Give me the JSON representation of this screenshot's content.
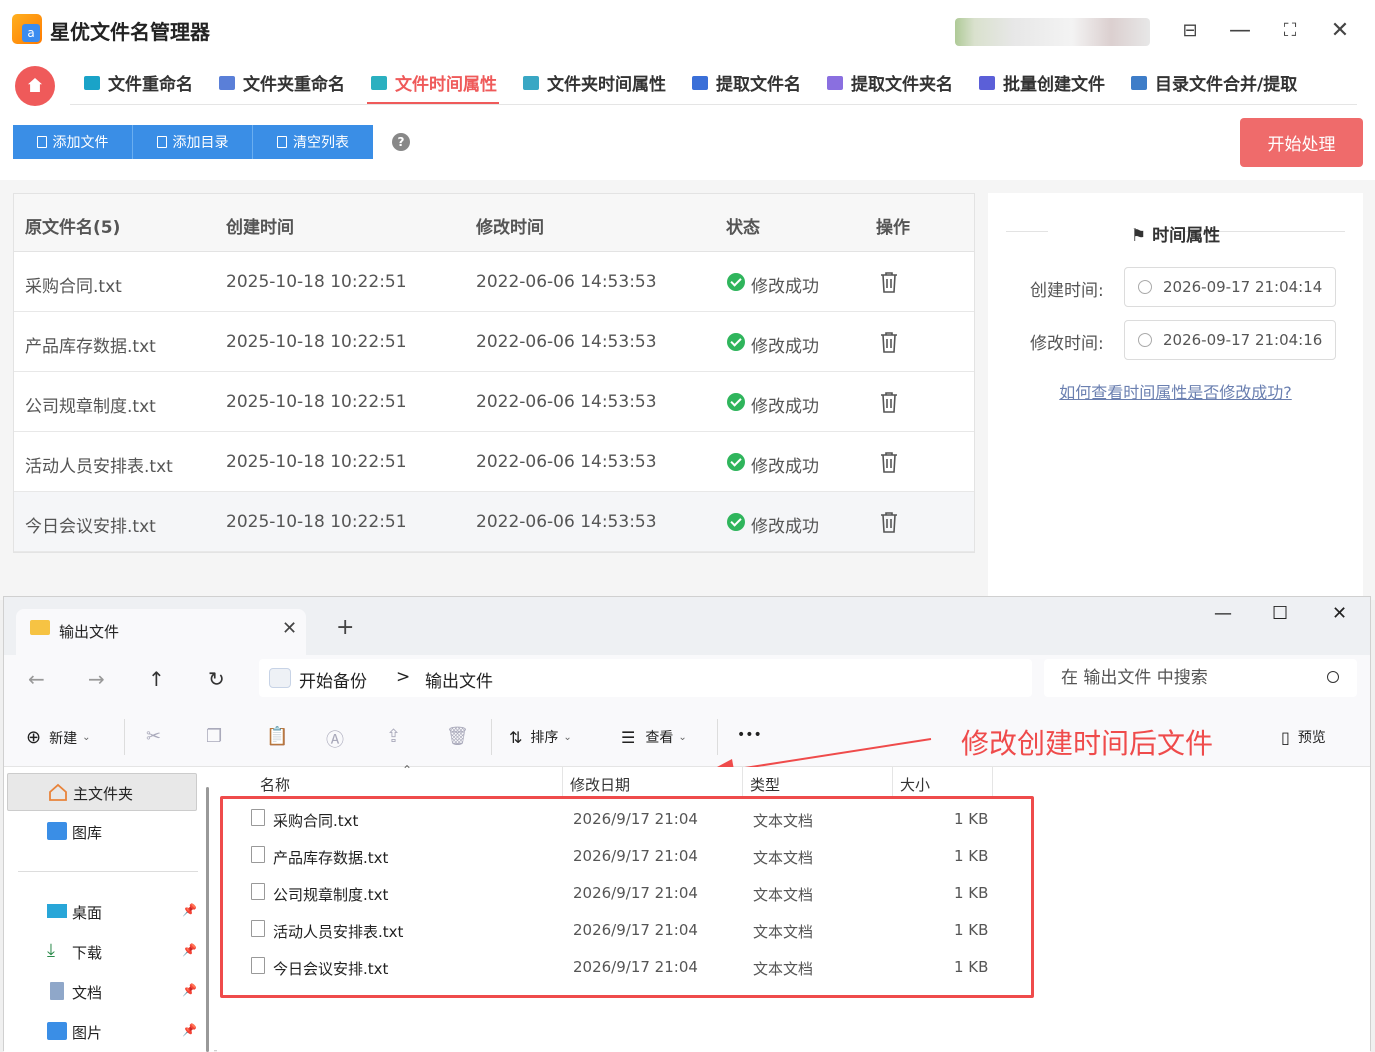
{
  "app": {
    "title": "星优文件名管理器",
    "logo_letter": "a",
    "window_controls": [
      "⊟",
      "—",
      "⛶",
      "✕"
    ]
  },
  "tabs": [
    {
      "label": "文件重命名",
      "color": "#1aa3c8",
      "active": false
    },
    {
      "label": "文件夹重命名",
      "color": "#5a7fd8",
      "active": false
    },
    {
      "label": "文件时间属性",
      "color": "#2bb0c0",
      "active": true
    },
    {
      "label": "文件夹时间属性",
      "color": "#39a7c4",
      "active": false
    },
    {
      "label": "提取文件名",
      "color": "#3a6fd8",
      "active": false
    },
    {
      "label": "提取文件夹名",
      "color": "#8a6fe0",
      "active": false
    },
    {
      "label": "批量创建文件",
      "color": "#5b5fd8",
      "active": false
    },
    {
      "label": "目录文件合并/提取",
      "color": "#3e7dc8",
      "active": false
    }
  ],
  "toolbar": {
    "add_file": "添加文件",
    "add_dir": "添加目录",
    "clear_list": "清空列表",
    "help": "?",
    "start": "开始处理"
  },
  "table": {
    "headers": {
      "name": "原文件名(5)",
      "created": "创建时间",
      "modified": "修改时间",
      "status": "状态",
      "action": "操作"
    },
    "rows": [
      {
        "name": "采购合同.txt",
        "created": "2025-10-18 10:22:51",
        "modified": "2022-06-06 14:53:53",
        "status": "修改成功"
      },
      {
        "name": "产品库存数据.txt",
        "created": "2025-10-18 10:22:51",
        "modified": "2022-06-06 14:53:53",
        "status": "修改成功"
      },
      {
        "name": "公司规章制度.txt",
        "created": "2025-10-18 10:22:51",
        "modified": "2022-06-06 14:53:53",
        "status": "修改成功"
      },
      {
        "name": "活动人员安排表.txt",
        "created": "2025-10-18 10:22:51",
        "modified": "2022-06-06 14:53:53",
        "status": "修改成功"
      },
      {
        "name": "今日会议安排.txt",
        "created": "2025-10-18 10:22:51",
        "modified": "2022-06-06 14:53:53",
        "status": "修改成功"
      }
    ]
  },
  "panel": {
    "title": "时间属性",
    "created_label": "创建时间:",
    "created_value": "2026-09-17 21:04:14",
    "modified_label": "修改时间:",
    "modified_value": "2026-09-17 21:04:16",
    "help_link": "如何查看时间属性是否修改成功?"
  },
  "explorer": {
    "tab_title": "输出文件",
    "new_tab": "+",
    "close_tab": "✕",
    "window_controls": [
      "—",
      "☐",
      "✕"
    ],
    "breadcrumb_root": "开始备份",
    "breadcrumb_sep": ">",
    "breadcrumb_current": "输出文件",
    "search_placeholder": "在 输出文件 中搜索",
    "commands": {
      "new": "新建",
      "sort": "排序",
      "view": "查看",
      "more": "•••",
      "preview": "预览"
    },
    "annotation": "修改创建时间后文件",
    "sidebar": [
      {
        "label": "主文件夹",
        "icon": "home-icon"
      },
      {
        "label": "图库",
        "icon": "gallery-icon"
      },
      {
        "label": "桌面",
        "icon": "desktop-icon"
      },
      {
        "label": "下载",
        "icon": "download-icon"
      },
      {
        "label": "文档",
        "icon": "document-icon"
      },
      {
        "label": "图片",
        "icon": "pictures-icon"
      }
    ],
    "columns": {
      "name": "名称",
      "date": "修改日期",
      "type": "类型",
      "size": "大小"
    },
    "files": [
      {
        "name": "采购合同.txt",
        "date": "2026/9/17 21:04",
        "type": "文本文档",
        "size": "1 KB"
      },
      {
        "name": "产品库存数据.txt",
        "date": "2026/9/17 21:04",
        "type": "文本文档",
        "size": "1 KB"
      },
      {
        "name": "公司规章制度.txt",
        "date": "2026/9/17 21:04",
        "type": "文本文档",
        "size": "1 KB"
      },
      {
        "name": "活动人员安排表.txt",
        "date": "2026/9/17 21:04",
        "type": "文本文档",
        "size": "1 KB"
      },
      {
        "name": "今日会议安排.txt",
        "date": "2026/9/17 21:04",
        "type": "文本文档",
        "size": "1 KB"
      }
    ]
  }
}
